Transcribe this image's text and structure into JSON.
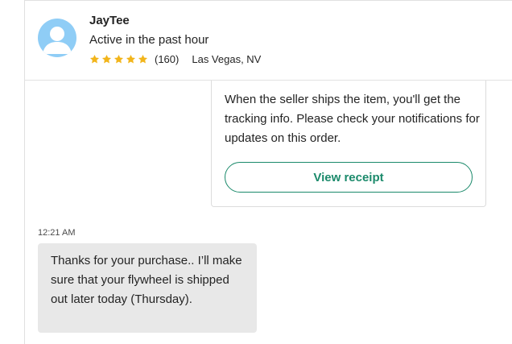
{
  "seller": {
    "name": "JayTee",
    "status": "Active in the past hour",
    "rating_stars": 5,
    "rating_count": "(160)",
    "location": "Las Vegas, NV",
    "avatar_color": "#8fcdf6",
    "star_color": "#f2b51b"
  },
  "receipt_card": {
    "text": "When the seller ships the item, you'll get the tracking info. Please check your notifications for updates on this order.",
    "button_label": "View receipt",
    "accent_color": "#1b8a6b"
  },
  "messages": [
    {
      "timestamp": "12:21 AM",
      "text": "Thanks for your purchase.. I’ll make sure that your flywheel is shipped out later today (Thursday)."
    }
  ]
}
